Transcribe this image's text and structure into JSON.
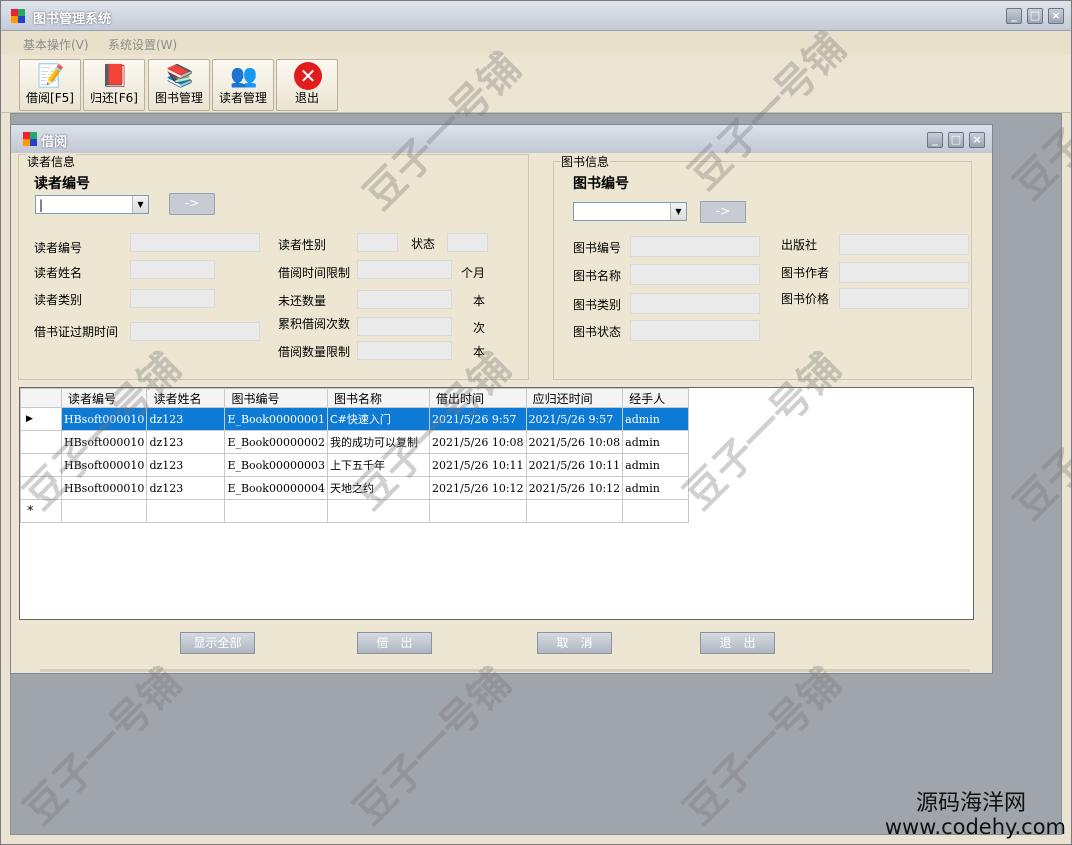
{
  "main_window": {
    "title": "图书管理系统"
  },
  "menu": [
    "基本操作(V)",
    "系统设置(W)"
  ],
  "toolbar": [
    {
      "label": "借阅[F5]",
      "icon": "pen-book-icon"
    },
    {
      "label": "归还[F6]",
      "icon": "red-book-icon"
    },
    {
      "label": "图书管理",
      "icon": "bookshelf-icon"
    },
    {
      "label": "读者管理",
      "icon": "users-icon"
    },
    {
      "label": "退出",
      "icon": "exit-icon"
    }
  ],
  "child_window": {
    "title": "借阅"
  },
  "reader_group": {
    "legend": "读者信息",
    "search_label": "读者编号",
    "go_button": "->",
    "labels": {
      "id": "读者编号",
      "name": "读者姓名",
      "type": "读者类别",
      "expire": "借书证过期时间",
      "gender": "读者性别",
      "status": "状态",
      "time_limit": "借阅时间限制",
      "unit_month": "个月",
      "unreturned": "未还数量",
      "unit_book1": "本",
      "total_times": "累积借阅次数",
      "unit_times": "次",
      "qty_limit": "借阅数量限制",
      "unit_book2": "本"
    }
  },
  "book_group": {
    "legend": "图书信息",
    "search_label": "图书编号",
    "go_button": "->",
    "labels": {
      "id": "图书编号",
      "name": "图书名称",
      "type": "图书类别",
      "status": "图书状态",
      "publisher": "出版社",
      "author": "图书作者",
      "price": "图书价格"
    }
  },
  "grid": {
    "columns": [
      "读者编号",
      "读者姓名",
      "图书编号",
      "图书名称",
      "借出时间",
      "应归还时间",
      "经手人"
    ],
    "rows": [
      [
        "HBsoft000010",
        "dz123",
        "E_Book00000001",
        "C#快速入门",
        "2021/5/26 9:57",
        "2021/5/26 9:57",
        "admin"
      ],
      [
        "HBsoft000010",
        "dz123",
        "E_Book00000002",
        "我的成功可以复制",
        "2021/5/26 10:08",
        "2021/5/26 10:08",
        "admin"
      ],
      [
        "HBsoft000010",
        "dz123",
        "E_Book00000003",
        "上下五千年",
        "2021/5/26 10:11",
        "2021/5/26 10:11",
        "admin"
      ],
      [
        "HBsoft000010",
        "dz123",
        "E_Book00000004",
        "天地之约",
        "2021/5/26 10:12",
        "2021/5/26 10:12",
        "admin"
      ]
    ],
    "selected_row": 0,
    "new_row_marker": "*"
  },
  "buttons": {
    "show_all": "显示全部",
    "lend": "借　出",
    "cancel": "取　消",
    "exit": "退　出"
  },
  "watermark": {
    "text": "豆子一号铺",
    "site_name": "源码海洋网",
    "site_url": "www.codehy.com"
  }
}
